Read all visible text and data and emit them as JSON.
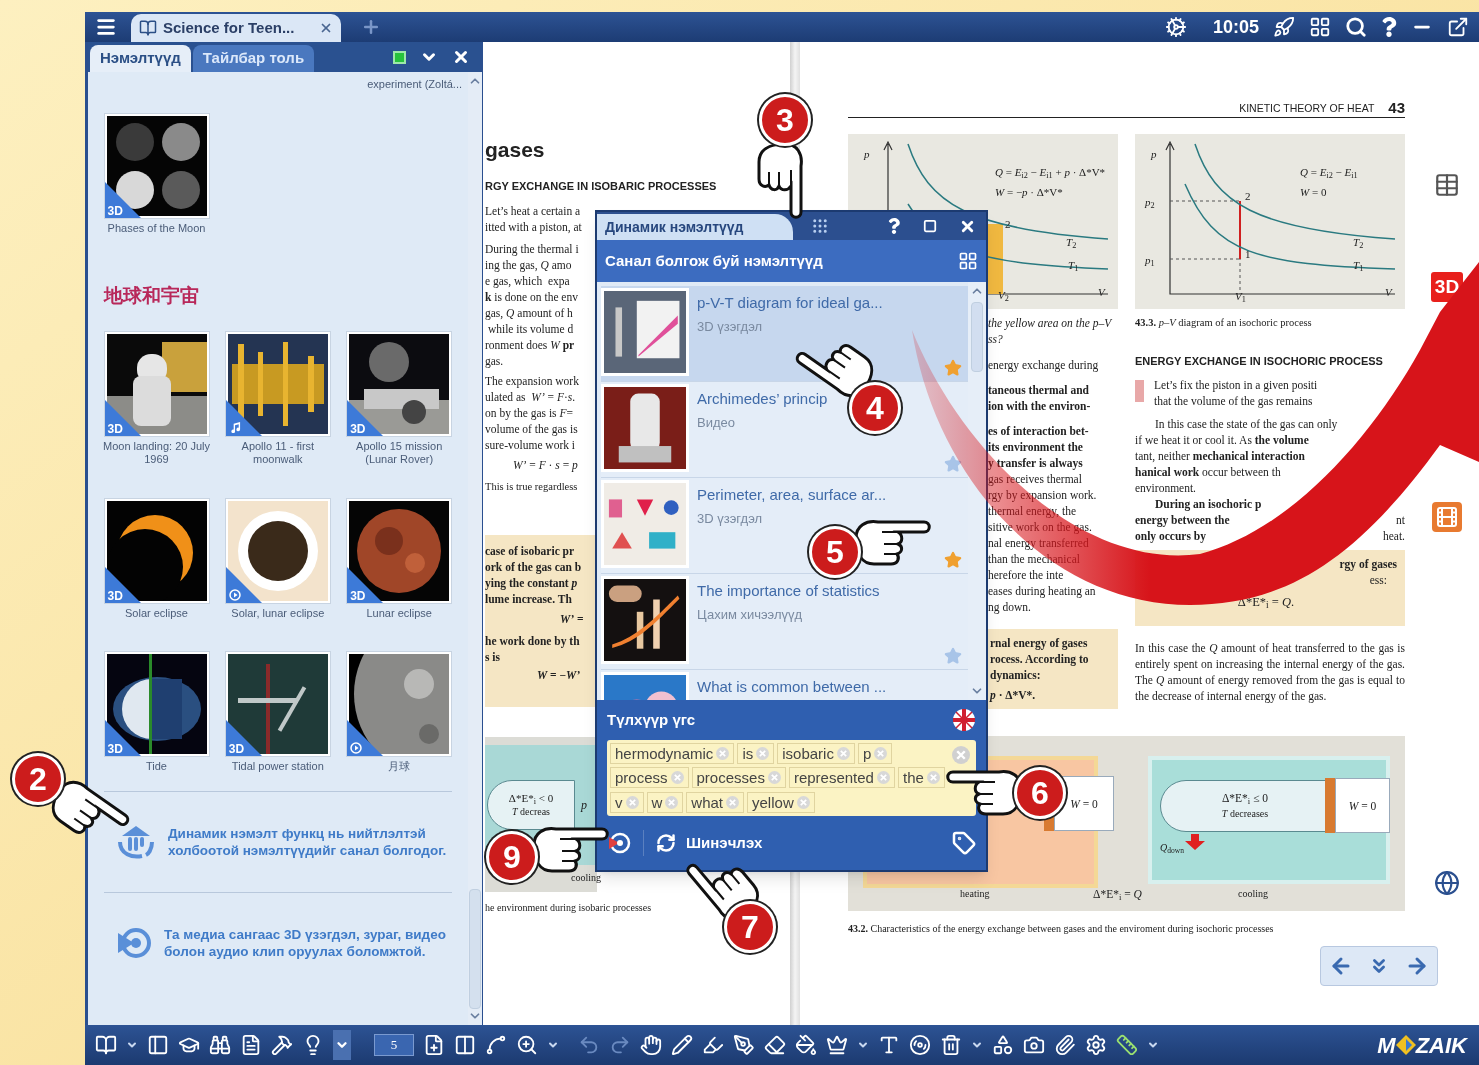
{
  "title_bar": {
    "tab_title": "Science for Teen...",
    "time": "10:05"
  },
  "side_panel": {
    "tabs": [
      {
        "label": "Нэмэлтүүд",
        "selected": true
      },
      {
        "label": "Тайлбар толь",
        "selected": false
      }
    ],
    "top_note": "experiment (Zoltá...",
    "first_item": {
      "title": "Phases of the Moon",
      "kind": "model",
      "badge": "3D"
    },
    "section_title": "地球和宇宙",
    "items": [
      {
        "title": "Moon landing: 20 July 1969",
        "kind": "model",
        "badge": "3D"
      },
      {
        "title": "Apollo 11 - first moonwalk",
        "kind": "audio"
      },
      {
        "title": "Apollo 15 mission (Lunar Rover)",
        "kind": "model",
        "badge": "3D"
      },
      {
        "title": "Solar eclipse",
        "kind": "model",
        "badge": "3D"
      },
      {
        "title": "Solar, lunar eclipse",
        "kind": "video"
      },
      {
        "title": "Lunar eclipse",
        "kind": "model",
        "badge": "3D"
      },
      {
        "title": "Tide",
        "kind": "model",
        "badge": "3D"
      },
      {
        "title": "Tidal power station",
        "kind": "model",
        "badge": "3D"
      },
      {
        "title": "月球",
        "kind": "video"
      }
    ],
    "hints": [
      {
        "kind": "dynamic",
        "text": "Динамик нэмэлт функц нь нийтлэлтэй холбоотой нэмэлтүүдийг санал болгодог."
      },
      {
        "kind": "media",
        "text": "Та медиа сангаас 3D үзэгдэл, зураг, видео болон аудио клип оруулах боломжтой."
      }
    ]
  },
  "left_page": {
    "heading": "gases",
    "subheading": "RGY EXCHANGE IN ISOBARIC PROCESSES",
    "para1": [
      "Let’s heat a certain a",
      "itted with a piston, at"
    ],
    "para2": [
      "During the thermal i",
      "ing the gas, *Q* amo",
      "e gas, which  expa",
      "**k** is done on the env",
      "gas, *Q* amount of h",
      " while its volume d",
      "ronment does *W* **pr**",
      "gas."
    ],
    "para3": [
      "The expansion work",
      "ulated as  *W’* = *F*·*s*.",
      "on by the gas is *F*=",
      "volume of the gas is",
      "sure-volume work i"
    ],
    "formula": "*W’* = *F* · *s* = *p*",
    "note": "This is true regardless",
    "box": [
      "case of isobaric pr",
      "ork of the gas can b",
      "ying the constant *p*",
      "lume increase. Th"
    ],
    "box_formula1": "*W’* =",
    "box2": [
      "he work done by th",
      "s is"
    ],
    "box_formula2": "*W* = −*W’*",
    "figure": {
      "delta": "Δ*E*$_{i}$ < 0",
      "temp": "*T* decreas",
      "pressure": "*p*",
      "label": "cooling"
    },
    "caption": "he environment during isobaric processes"
  },
  "right_page": {
    "header": "KINETIC THEORY OF HEAT",
    "page_number": "43",
    "graph_a": {
      "p": "*p*",
      "formula1": "*Q* = *E*$_{i2}$ − *E*$_{i1}$ + *p* · Δ*V*",
      "formula2": "*W* = −*p* · Δ*V*",
      "point": "2",
      "t2": "*T*$_{2}$",
      "t1": "*T*$_{1}$",
      "v2": "*V*$_{2}$",
      "v": "*V*"
    },
    "caption_a": [
      "the yellow area on the p–V",
      "ss?"
    ],
    "col_a": [
      [
        "energy exchange during"
      ],
      [
        "**taneous thermal and**",
        "**ion with the environ-**"
      ],
      [
        "**es of interaction bet-**",
        "**its environment the**",
        "**y transfer is always**",
        "gas receives thermal",
        "rgy by expansion work.",
        "thermal energy, the",
        "sitive work on the gas.",
        "nal energy transferred",
        "than the mechanical",
        "herefore the inte",
        "eases during heating an",
        "ng down."
      ]
    ],
    "box_a": [
      "rnal energy of gases",
      "rocess. According to",
      "dynamics:"
    ],
    "box_a_formula": "*p* · Δ*V*.",
    "graph_b": {
      "p": "*p*",
      "formula1": "*Q* = *E*$_{i2}$ − *E*$_{i1}$",
      "formula2": "*W* = 0",
      "p2": "*p*$_{2}$",
      "p1": "*p*$_{1}$",
      "point2": "2",
      "point1": "1",
      "t2": "*T*$_{2}$",
      "t1": "*T*$_{1}$",
      "v1": "*V*$_{1}$",
      "v": "*V*"
    },
    "caption_b": "**43.3.** *p–V* diagram of an isochoric process",
    "heading_b": "ENERGY EXCHANGE IN ISOCHORIC PROCESS",
    "marked_para": [
      "Let’s fix the piston in a given positi",
      "that the volume of the gas remains"
    ],
    "col_b": [
      {
        "text": "In this case the state of the gas can only"
      },
      {
        "text": "if we heat it or cool it. As **the volume**"
      },
      {
        "text": "tant, neither **mechanical interaction**"
      },
      {
        "text": "**hanical work** occur between th"
      },
      {
        "text": "environment."
      },
      {
        "text": "**During an isochoric p**"
      },
      {
        "text": "**energy between the**",
        "tail": "nt"
      },
      {
        "text": "**only occurs by**",
        "tail": "heat."
      }
    ],
    "box_b": [
      "rgy of gases",
      "ess:"
    ],
    "box_b_formula": "Δ*E*$_{i}$ = *Q*.",
    "para_b": "In this case the *Q* amount of heat transferred to the gas is entirely spent on increasing the internal energy of the gas. The *Q* amount of energy removed from the gas is equal to the decrease of internal energy of the gas.",
    "figure": {
      "w_left": "*W* = 0",
      "heating": "heating",
      "delta_q": "Δ*E*$_{i}$ = *Q*",
      "delta": "Δ*E*$_{i}$ ≤ 0",
      "temp": "*T* decreases",
      "q_down": "*Q*$_{down}$",
      "w_right": "*W* = 0",
      "cooling": "cooling"
    },
    "caption": "**43.2.** Characteristics of  the energy exchange between gases and the enviroment during isochoric processes"
  },
  "side_tools": {
    "badge": "3D"
  },
  "dialog": {
    "title": "Динамик нэмэлтүүд",
    "header": "Санал болгож буй нэмэлтүүд",
    "items": [
      {
        "title": "p-V-T diagram  for ideal ga...",
        "subtitle": "3D үзэгдэл",
        "starred": true,
        "selected": true
      },
      {
        "title": "Archimedes’ princip",
        "subtitle": "Видео",
        "starred": false,
        "selected": false
      },
      {
        "title": "Perimeter, area, surface ar...",
        "subtitle": "3D үзэгдэл",
        "starred": true,
        "selected": false
      },
      {
        "title": "The importance of statistics",
        "subtitle": "Цахим хичээлүүд",
        "starred": false,
        "selected": false
      },
      {
        "title": "What is common between ...",
        "selected": false
      }
    ],
    "keywords_title": "Түлхүүр үгс",
    "keywords": [
      "hermodynamic",
      "is",
      "isobaric",
      "p",
      "process",
      "processes",
      "represented",
      "the",
      "v",
      "w",
      "what",
      "yellow"
    ],
    "refresh": "Шинэчлэх"
  },
  "toolbar": {
    "page": "5",
    "logo_left": "M",
    "logo_right": "ZAIK"
  },
  "callouts": [
    {
      "label": "2"
    },
    {
      "label": "3"
    },
    {
      "label": "4"
    },
    {
      "label": "5"
    },
    {
      "label": "6"
    },
    {
      "label": "7"
    },
    {
      "label": "9"
    }
  ]
}
